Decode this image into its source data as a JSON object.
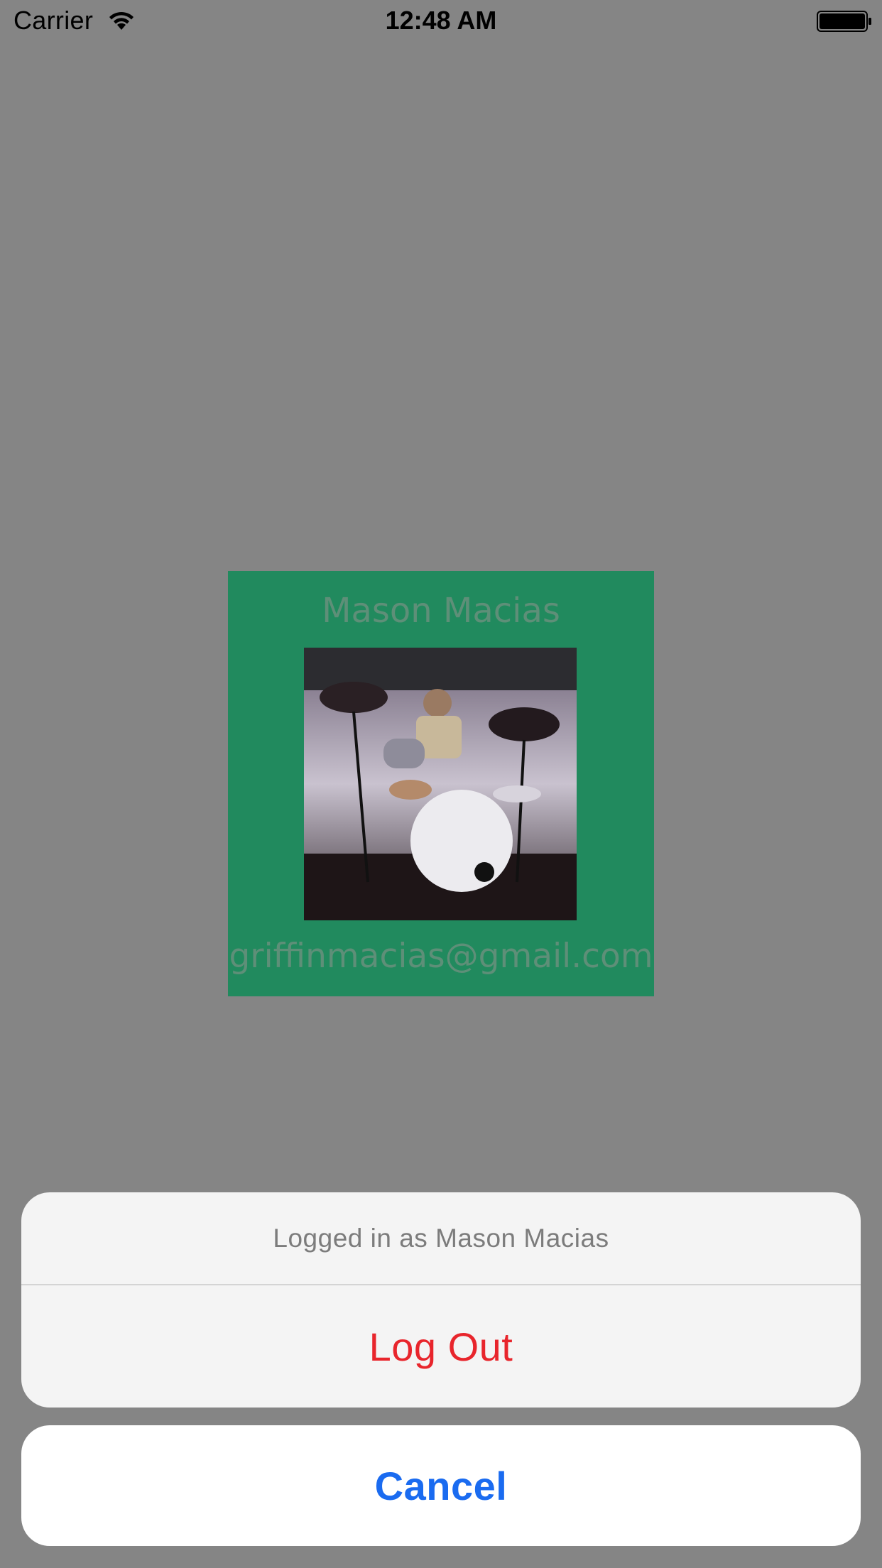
{
  "status_bar": {
    "carrier": "Carrier",
    "time": "12:48 AM",
    "wifi_icon": "wifi-icon",
    "battery_icon": "battery-icon"
  },
  "profile": {
    "name": "Mason Macias",
    "email": "griffinmacias@gmail.com",
    "photo": "profile-photo",
    "background_color": "#218a5e",
    "text_color": "#5e8f78"
  },
  "action_sheet": {
    "title": "Logged in as Mason Macias",
    "logout_label": "Log Out",
    "cancel_label": "Cancel",
    "destructive_color": "#e8252c",
    "cancel_color": "#1a6bf0"
  }
}
